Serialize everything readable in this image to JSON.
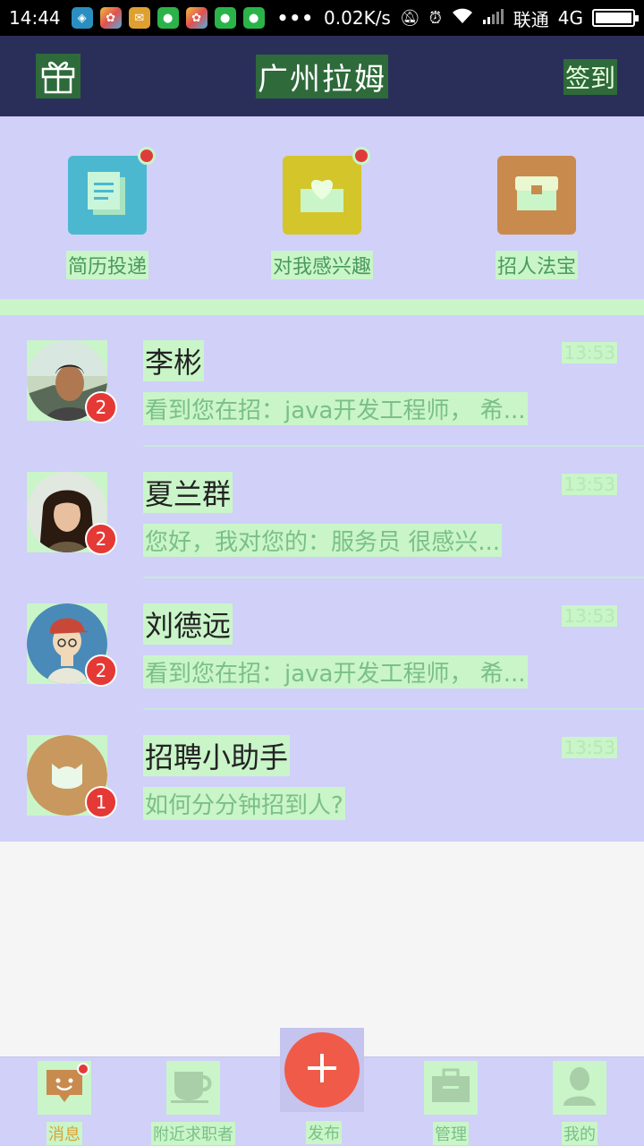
{
  "status_bar": {
    "time": "14:44",
    "dots": "•••",
    "net_speed": "0.02K/s",
    "carrier": "联通",
    "network": "4G",
    "battery_level": 1.0,
    "icons": [
      "shield-app-icon",
      "photos-app-icon",
      "mail-app-icon",
      "wechat-icon",
      "photos-app-icon",
      "message-icon",
      "wechat-icon"
    ],
    "system_icons": [
      "mute-icon",
      "alarm-icon",
      "wifi-icon",
      "signal-icon"
    ]
  },
  "header": {
    "title": "广州拉姆",
    "checkin": "签到",
    "left_icon": "gift-icon"
  },
  "shortcuts": [
    {
      "label": "简历投递",
      "color": "#4bb8d0",
      "icon": "resume-icon",
      "has_dot": true
    },
    {
      "label": "对我感兴趣",
      "color": "#d4c52a",
      "icon": "heart-box-icon",
      "has_dot": true
    },
    {
      "label": "招人法宝",
      "color": "#c98a4e",
      "icon": "treasure-box-icon",
      "has_dot": false
    }
  ],
  "conversations": [
    {
      "name": "李彬",
      "time": "13:53",
      "message": "看到您在招：java开发工程师，  希...",
      "badge": "2"
    },
    {
      "name": "夏兰群",
      "time": "13:53",
      "message": "您好，我对您的：服务员 很感兴...",
      "badge": "2"
    },
    {
      "name": "刘德远",
      "time": "13:53",
      "message": "看到您在招：java开发工程师，  希...",
      "badge": "2"
    },
    {
      "name": "招聘小助手",
      "time": "13:53",
      "message": "如何分分钟招到人?",
      "badge": "1"
    }
  ],
  "bottom_nav": {
    "items": [
      {
        "label": "消息",
        "icon": "message-bubble-icon",
        "active": true
      },
      {
        "label": "附近求职者",
        "icon": "coffee-cup-icon",
        "active": false
      },
      {
        "label": "发布",
        "icon": "plus-icon",
        "active": false
      },
      {
        "label": "管理",
        "icon": "briefcase-icon",
        "active": false
      },
      {
        "label": "我的",
        "icon": "person-icon",
        "active": false
      }
    ]
  }
}
